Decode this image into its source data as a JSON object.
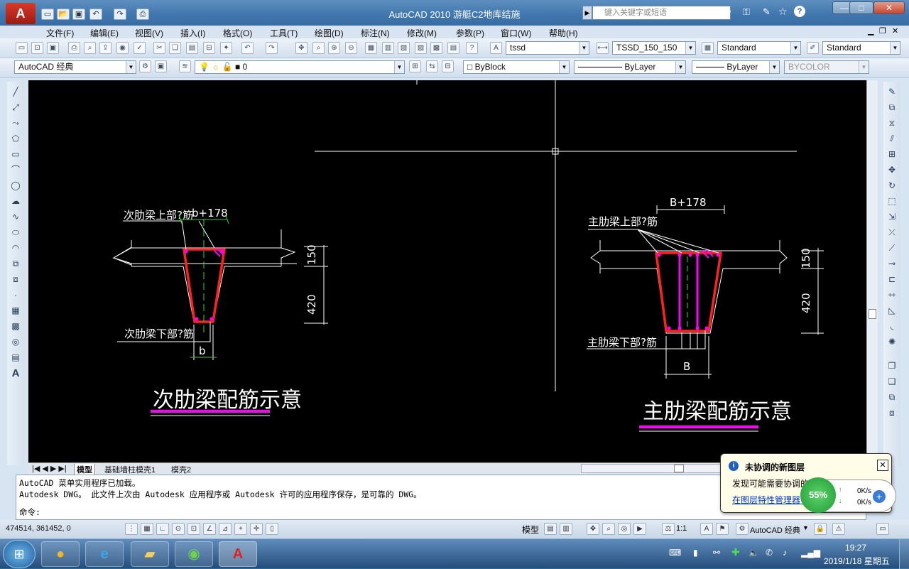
{
  "window": {
    "title": "AutoCAD 2010      游艇C2地库结施",
    "search_placeholder": "键入关键字或短语",
    "min": "—",
    "max": "□",
    "close": "✕"
  },
  "menu": [
    "文件(F)",
    "编辑(E)",
    "视图(V)",
    "插入(I)",
    "格式(O)",
    "工具(T)",
    "绘图(D)",
    "标注(N)",
    "修改(M)",
    "参数(P)",
    "窗口(W)",
    "帮助(H)"
  ],
  "toolbar1": {
    "text_style": "tssd",
    "dim_style": "TSSD_150_150",
    "table_style": "Standard",
    "multileader_style": "Standard"
  },
  "toolbar2": {
    "workspace": "AutoCAD 经典",
    "layer": "0",
    "color": "ByBlock",
    "linetype": "ByLayer",
    "lineweight": "ByLayer",
    "plotstyle": "BYCOLOR"
  },
  "drawing": {
    "left": {
      "top_bar_label": "次肋梁上部?筋",
      "width_label": "b+178",
      "bottom_bar_label": "次肋梁下部?筋",
      "bottom_width": "b",
      "dim_top": "150",
      "dim_depth": "420",
      "caption": "次肋梁配筋示意"
    },
    "right": {
      "width_label": "B+178",
      "top_bar_label": "主肋梁上部?筋",
      "bottom_bar_label": "主肋梁下部?筋",
      "bottom_width": "B",
      "dim_top": "150",
      "dim_depth": "420",
      "caption": "主肋梁配筋示意"
    },
    "colors": {
      "rebar": "#ff2020",
      "accent": "#ff00ff",
      "green": "#20e020"
    }
  },
  "tabs": [
    "模型",
    "基础墙柱模壳1",
    "模壳2"
  ],
  "command": {
    "line1": "AutoCAD 菜单实用程序已加载。",
    "line2": "Autodesk DWG。  此文件上次由 Autodesk 应用程序或 Autodesk 许可的应用程序保存，是可靠的 DWG。",
    "prompt": "命令:"
  },
  "status": {
    "coords": "474514, 361452, 0",
    "model": "模型",
    "scale": "1:1",
    "workspace": "AutoCAD 经典"
  },
  "balloon": {
    "title": "未协调的新图层",
    "text": "发现可能需要协调的新图层",
    "link": "在图层特性管理器中",
    "percent": "55%",
    "up": "0K/s",
    "down": "0K/s"
  },
  "clock": {
    "time": "19:27",
    "date": "2019/1/18 星期五"
  }
}
